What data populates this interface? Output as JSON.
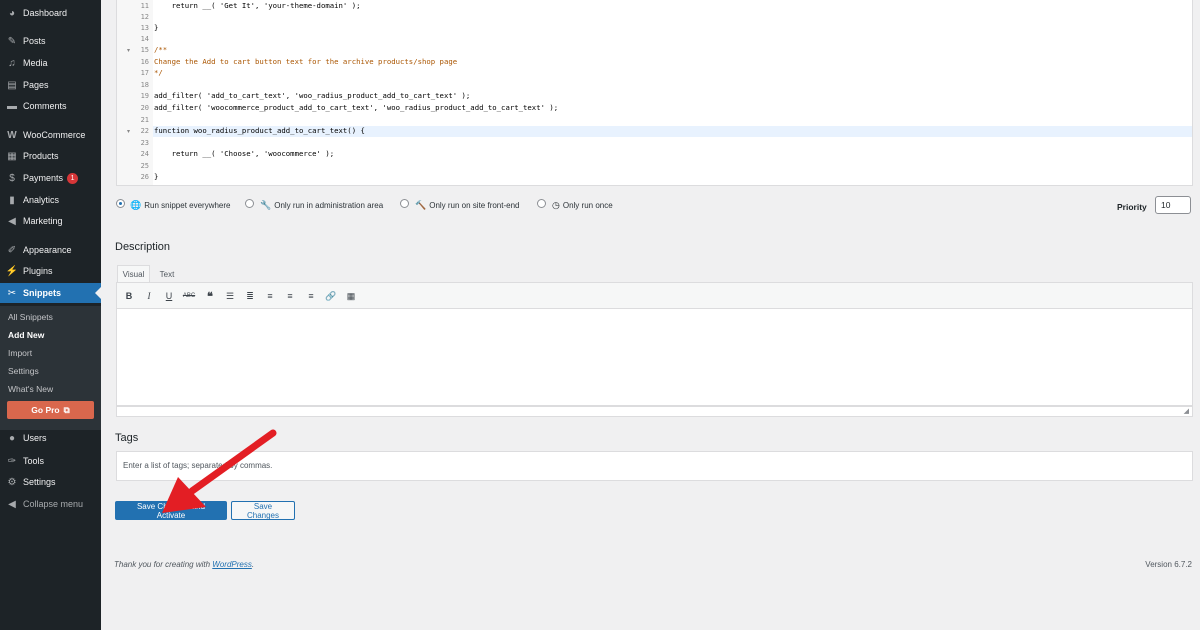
{
  "sidebar": {
    "items": [
      {
        "label": "Dashboard",
        "icon": "dashboard-icon"
      },
      {
        "label": "Posts",
        "icon": "pin-icon"
      },
      {
        "label": "Media",
        "icon": "media-icon"
      },
      {
        "label": "Pages",
        "icon": "page-icon"
      },
      {
        "label": "Comments",
        "icon": "comment-icon"
      },
      {
        "label": "WooCommerce",
        "icon": "woo-icon"
      },
      {
        "label": "Products",
        "icon": "archive-icon"
      },
      {
        "label": "Payments",
        "icon": "dollar-icon",
        "badge": "1"
      },
      {
        "label": "Analytics",
        "icon": "chart-bar-icon"
      },
      {
        "label": "Marketing",
        "icon": "megaphone-icon"
      },
      {
        "label": "Appearance",
        "icon": "paintbrush-icon"
      },
      {
        "label": "Plugins",
        "icon": "plugin-icon"
      },
      {
        "label": "Snippets",
        "icon": "scissors-icon"
      },
      {
        "label": "Users",
        "icon": "user-icon"
      },
      {
        "label": "Tools",
        "icon": "wrench-icon"
      },
      {
        "label": "Settings",
        "icon": "settings-icon"
      },
      {
        "label": "Collapse menu",
        "icon": "collapse-icon"
      }
    ],
    "submenu": [
      "All Snippets",
      "Add New",
      "Import",
      "Settings",
      "What's New"
    ],
    "gopro": "Go Pro"
  },
  "code": {
    "lines": [
      {
        "n": "11",
        "text": "    return __( 'Get It', 'your-theme-domain' );"
      },
      {
        "n": "12",
        "text": ""
      },
      {
        "n": "13",
        "text": "}"
      },
      {
        "n": "14",
        "text": ""
      },
      {
        "n": "15",
        "text": "/**"
      },
      {
        "n": "16",
        "text": "Change the Add to cart button text for the archive products/shop page"
      },
      {
        "n": "17",
        "text": "*/"
      },
      {
        "n": "18",
        "text": ""
      },
      {
        "n": "19",
        "text": "add_filter( 'add_to_cart_text', 'woo_radius_product_add_to_cart_text' );"
      },
      {
        "n": "20",
        "text": "add_filter( 'woocommerce_product_add_to_cart_text', 'woo_radius_product_add_to_cart_text' );"
      },
      {
        "n": "21",
        "text": ""
      },
      {
        "n": "22",
        "text": "function woo_radius_product_add_to_cart_text() {"
      },
      {
        "n": "23",
        "text": ""
      },
      {
        "n": "24",
        "text": "    return __( 'Choose', 'woocommerce' );"
      },
      {
        "n": "25",
        "text": ""
      },
      {
        "n": "26",
        "text": "}"
      }
    ]
  },
  "run_options": {
    "everywhere": "Run snippet everywhere",
    "admin": "Only run in administration area",
    "frontend": "Only run on site front-end",
    "once": "Only run once",
    "selected": "everywhere"
  },
  "priority": {
    "label": "Priority",
    "value": "10"
  },
  "description": {
    "heading": "Description",
    "tab_visual": "Visual",
    "tab_text": "Text"
  },
  "tags": {
    "heading": "Tags",
    "placeholder": "Enter a list of tags; separated by commas."
  },
  "buttons": {
    "save_activate": "Save Changes and Activate",
    "save": "Save Changes"
  },
  "footer": {
    "thanks_prefix": "Thank you for creating with ",
    "wordpress_link": "WordPress",
    "thanks_suffix": ".",
    "version": "Version 6.7.2"
  },
  "colors": {
    "accent": "#2271b1",
    "sidebar": "#1d2327",
    "arrow": "#e31e24",
    "gopro": "#d9674d"
  }
}
